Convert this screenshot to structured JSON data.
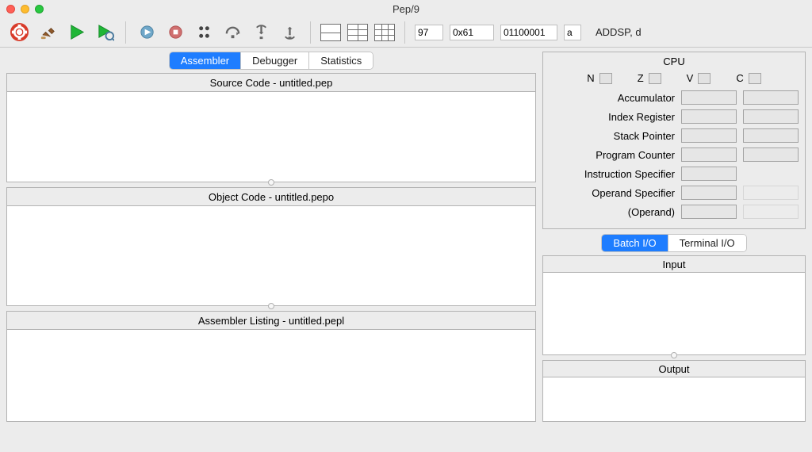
{
  "window": {
    "title": "Pep/9"
  },
  "toolbar": {
    "dec": "97",
    "hex": "0x61",
    "bin": "01100001",
    "char": "a",
    "mnemonic": "ADDSP, d"
  },
  "tabs": {
    "assembler": "Assembler",
    "debugger": "Debugger",
    "statistics": "Statistics",
    "active": "assembler"
  },
  "panels": {
    "source_title": "Source Code - untitled.pep",
    "object_title": "Object Code - untitled.pepo",
    "listing_title": "Assembler Listing - untitled.pepl"
  },
  "cpu": {
    "title": "CPU",
    "flags": {
      "N": "N",
      "Z": "Z",
      "V": "V",
      "C": "C"
    },
    "registers": {
      "accumulator": "Accumulator",
      "index_register": "Index Register",
      "stack_pointer": "Stack Pointer",
      "program_counter": "Program Counter",
      "instruction_specifier": "Instruction Specifier",
      "operand_specifier": "Operand Specifier",
      "operand": "(Operand)"
    }
  },
  "io": {
    "batch_tab": "Batch I/O",
    "terminal_tab": "Terminal I/O",
    "input_label": "Input",
    "output_label": "Output"
  }
}
